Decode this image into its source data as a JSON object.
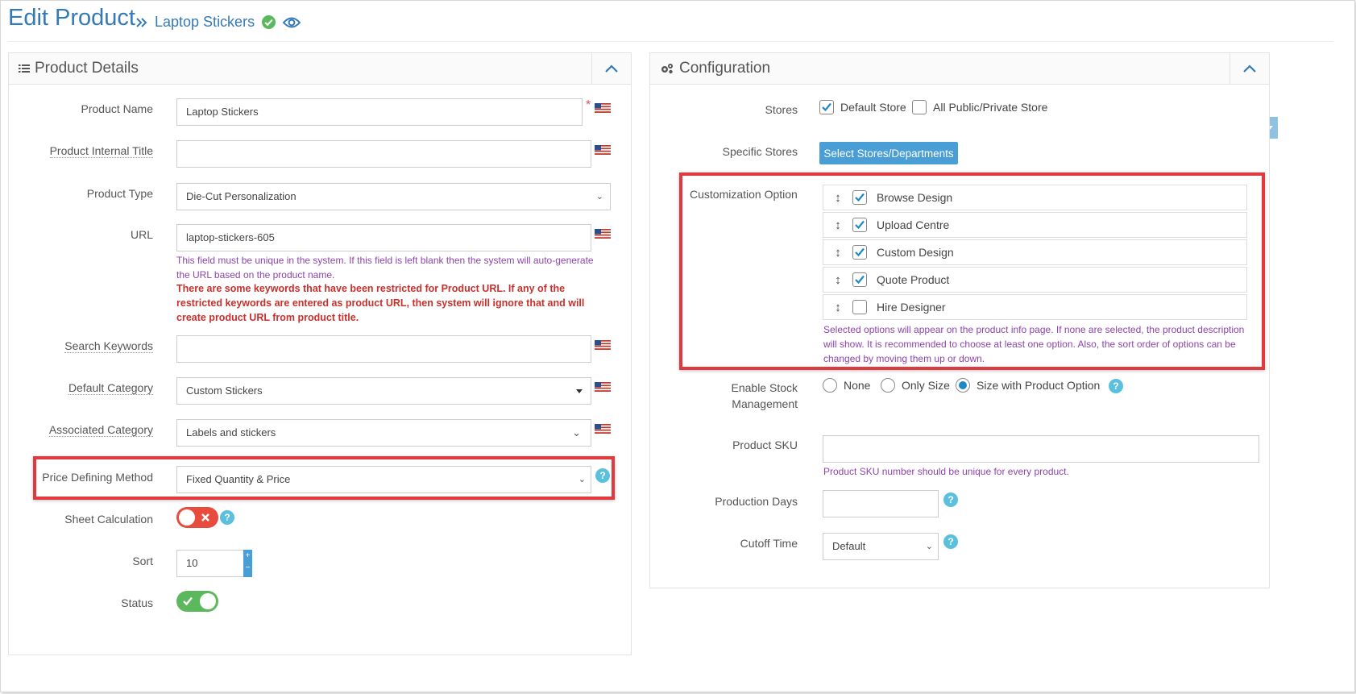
{
  "header": {
    "title": "Edit Product",
    "breadcrumb": "Laptop Stickers"
  },
  "left_panel": {
    "title": "Product Details",
    "fields": {
      "product_name": {
        "label": "Product Name",
        "value": "Laptop Stickers",
        "required": "*"
      },
      "internal_title": {
        "label": "Product Internal Title",
        "value": ""
      },
      "product_type": {
        "label": "Product Type",
        "value": "Die-Cut Personalization"
      },
      "url": {
        "label": "URL",
        "value": "laptop-stickers-605",
        "note": "This field must be unique in the system. If this field is left blank then the system will auto-generate the URL based on the product name.",
        "warning": "There are some keywords that have been restricted for Product URL. If any of the restricted keywords are entered as product URL, then system will ignore that and will create product URL from product title."
      },
      "search_keywords": {
        "label": "Search Keywords",
        "value": ""
      },
      "default_category": {
        "label": "Default Category",
        "value": "Custom Stickers"
      },
      "associated_category": {
        "label": "Associated Category",
        "value": "Labels and stickers"
      },
      "price_method": {
        "label": "Price Defining Method",
        "value": "Fixed Quantity & Price"
      },
      "sheet_calc": {
        "label": "Sheet Calculation",
        "state": "off"
      },
      "sort": {
        "label": "Sort",
        "value": "10"
      },
      "status": {
        "label": "Status",
        "state": "on"
      }
    }
  },
  "right_panel": {
    "title": "Configuration",
    "stores": {
      "label": "Stores",
      "options": [
        {
          "label": "Default Store",
          "checked": true
        },
        {
          "label": "All Public/Private Store",
          "checked": false
        }
      ]
    },
    "specific_stores": {
      "label": "Specific Stores",
      "button": "Select Stores/Departments"
    },
    "customization": {
      "label": "Customization Option",
      "options": [
        {
          "label": "Browse Design",
          "checked": true
        },
        {
          "label": "Upload Centre",
          "checked": true
        },
        {
          "label": "Custom Design",
          "checked": true
        },
        {
          "label": "Quote Product",
          "checked": true
        },
        {
          "label": "Hire Designer",
          "checked": false
        }
      ],
      "note": "Selected options will appear on the product info page. If none are selected, the product description will show. It is recommended to choose at least one option. Also, the sort order of options can be changed by moving them up or down."
    },
    "stock": {
      "label_line1": "Enable Stock",
      "label_line2": "Management",
      "options": [
        {
          "label": "None",
          "selected": false
        },
        {
          "label": "Only Size",
          "selected": false
        },
        {
          "label": "Size with Product Option",
          "selected": true
        }
      ]
    },
    "sku": {
      "label": "Product SKU",
      "value": "",
      "note": "Product SKU number should be unique for every product."
    },
    "production_days": {
      "label": "Production Days",
      "value": ""
    },
    "cutoff": {
      "label": "Cutoff Time",
      "value": "Default"
    }
  },
  "colors": {
    "accent": "#337ab7",
    "highlight": "#e0393e",
    "success": "#5cb85c",
    "danger": "#e74c3c",
    "help": "#5bc0de"
  },
  "icons": [
    "double-chevron-right-icon",
    "check-circle-icon",
    "eye-icon",
    "list-icon",
    "cogs-icon",
    "chevron-up-icon",
    "us-flag-icon",
    "help-icon",
    "sort-arrows-icon"
  ]
}
